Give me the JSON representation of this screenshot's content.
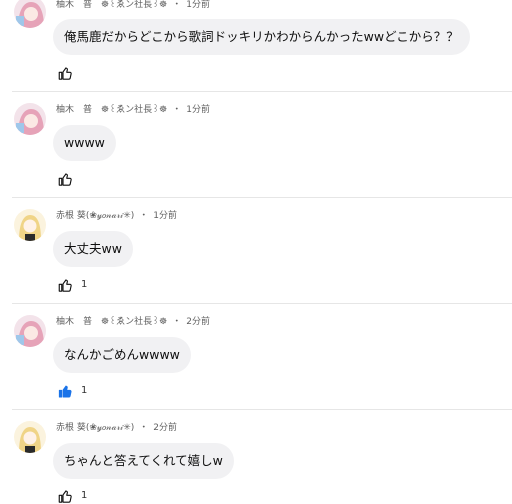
{
  "comments": [
    {
      "author": "柚木　普　☸꒰ゑン社長꒱☸",
      "time": "1分前",
      "text": "俺馬鹿だからどこから歌詞ドッキリかわからんかったwwどこから？？",
      "likes": "",
      "liked": false,
      "avatar": "pink-hair-avatar"
    },
    {
      "author": "柚木　普　☸꒰ゑン社長꒱☸",
      "time": "1分前",
      "text": "wwww",
      "likes": "",
      "liked": false,
      "avatar": "pink-hair-avatar"
    },
    {
      "author": "赤根 葵(❀𝓎𝑜𝓃𝒶𝓇𝒾✳︎)",
      "time": "1分前",
      "text": "大丈夫ww",
      "likes": "1",
      "liked": false,
      "avatar": "blonde-hair-avatar"
    },
    {
      "author": "柚木　普　☸꒰ゑン社長꒱☸",
      "time": "2分前",
      "text": "なんかごめんwwww",
      "likes": "1",
      "liked": true,
      "avatar": "pink-hair-avatar"
    },
    {
      "author": "赤根 葵(❀𝓎𝑜𝓃𝒶𝓇𝒾✳︎)",
      "time": "2分前",
      "text": "ちゃんと答えてくれて嬉しw",
      "likes": "1",
      "liked": false,
      "avatar": "blonde-hair-avatar"
    }
  ],
  "separator": "・",
  "colors": {
    "bubble": "#f1f1f3",
    "liked_icon": "#1a73e8",
    "icon": "#0f0f0f",
    "meta_text": "#606060"
  }
}
